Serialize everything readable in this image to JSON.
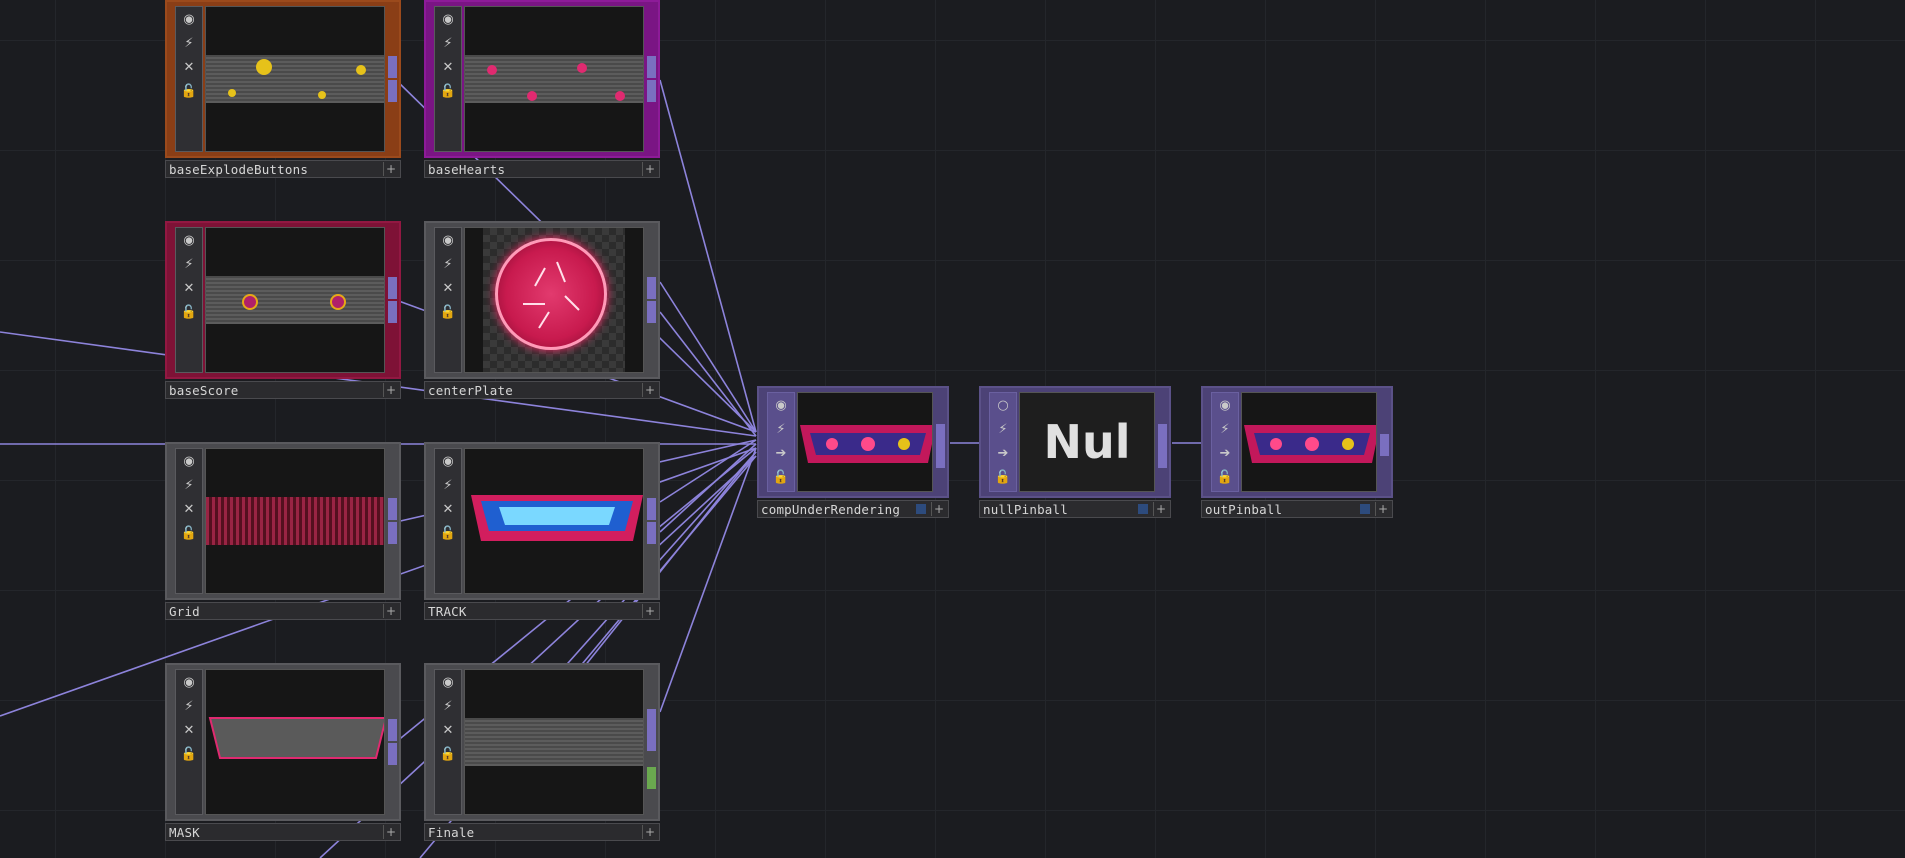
{
  "colors": {
    "wire": "#9a8ff0",
    "background": "#1b1c20"
  },
  "toolbar_icons": [
    "viewer-icon",
    "cook-icon",
    "bypass-icon",
    "lock-icon"
  ],
  "nodes": {
    "baseExplodeButtons": {
      "label": "baseExplodeButtons"
    },
    "baseHearts": {
      "label": "baseHearts"
    },
    "baseScore": {
      "label": "baseScore"
    },
    "centerPlate": {
      "label": "centerPlate"
    },
    "Grid": {
      "label": "Grid"
    },
    "TRACK": {
      "label": "TRACK"
    },
    "MASK": {
      "label": "MASK"
    },
    "Finale": {
      "label": "Finale"
    },
    "compUnderRendering": {
      "label": "compUnderRendering"
    },
    "nullPinball": {
      "label": "nullPinball",
      "viewer_text": "Nul"
    },
    "outPinball": {
      "label": "outPinball"
    }
  },
  "glyphs": {
    "viewer": "◉",
    "cook": "⚡",
    "bypass": "✕",
    "lock": "🔓",
    "arrow": "➔",
    "circle": "○",
    "plus": "+"
  }
}
